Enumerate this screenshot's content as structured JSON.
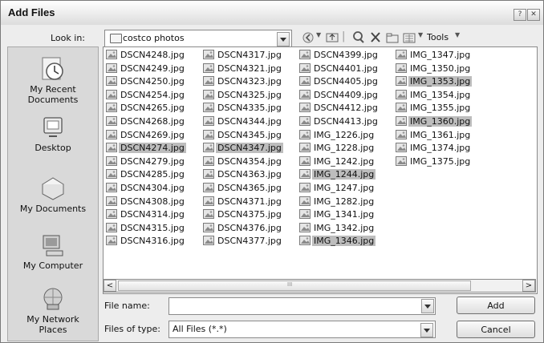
{
  "window": {
    "title": "Add Files",
    "help_btn": "?",
    "close_btn": "✕"
  },
  "look_in": {
    "label": "Look in:",
    "value": "costco photos"
  },
  "toolbar": {
    "tools_label": "Tools"
  },
  "places": [
    {
      "label": "My Recent Documents",
      "icon": "recent-documents-icon"
    },
    {
      "label": "Desktop",
      "icon": "desktop-icon"
    },
    {
      "label": "My Documents",
      "icon": "my-documents-icon"
    },
    {
      "label": "My Computer",
      "icon": "my-computer-icon"
    },
    {
      "label": "My Network Places",
      "icon": "network-places-icon"
    }
  ],
  "files": {
    "columns": [
      [
        "DSCN4248.jpg",
        "DSCN4249.jpg",
        "DSCN4250.jpg",
        "DSCN4254.jpg",
        "DSCN4265.jpg",
        "DSCN4268.jpg",
        "DSCN4269.jpg",
        "DSCN4274.jpg",
        "DSCN4279.jpg",
        "DSCN4285.jpg",
        "DSCN4304.jpg",
        "DSCN4308.jpg",
        "DSCN4314.jpg",
        "DSCN4315.jpg",
        "DSCN4316.jpg"
      ],
      [
        "DSCN4317.jpg",
        "DSCN4321.jpg",
        "DSCN4323.jpg",
        "DSCN4325.jpg",
        "DSCN4335.jpg",
        "DSCN4344.jpg",
        "DSCN4345.jpg",
        "DSCN4347.jpg",
        "DSCN4354.jpg",
        "DSCN4363.jpg",
        "DSCN4365.jpg",
        "DSCN4371.jpg",
        "DSCN4375.jpg",
        "DSCN4376.jpg",
        "DSCN4377.jpg"
      ],
      [
        "DSCN4399.jpg",
        "DSCN4401.jpg",
        "DSCN4405.jpg",
        "DSCN4409.jpg",
        "DSCN4412.jpg",
        "DSCN4413.jpg",
        "IMG_1226.jpg",
        "IMG_1228.jpg",
        "IMG_1242.jpg",
        "IMG_1244.jpg",
        "IMG_1247.jpg",
        "IMG_1282.jpg",
        "IMG_1341.jpg",
        "IMG_1342.jpg",
        "IMG_1346.jpg"
      ],
      [
        "IMG_1347.jpg",
        "IMG_1350.jpg",
        "IMG_1353.jpg",
        "IMG_1354.jpg",
        "IMG_1355.jpg",
        "IMG_1360.jpg",
        "IMG_1361.jpg",
        "IMG_1374.jpg",
        "IMG_1375.jpg"
      ]
    ],
    "selected": [
      "DSCN4274.jpg",
      "DSCN4347.jpg",
      "IMG_1244.jpg",
      "IMG_1346.jpg",
      "IMG_1353.jpg",
      "IMG_1360.jpg"
    ]
  },
  "scrollbar": {
    "left_arrow": "<",
    "right_arrow": ">",
    "grip": "III"
  },
  "filename": {
    "label": "File name:",
    "value": ""
  },
  "filetype": {
    "label": "Files of type:",
    "value": "All Files (*.*)"
  },
  "buttons": {
    "add": "Add",
    "cancel": "Cancel"
  }
}
